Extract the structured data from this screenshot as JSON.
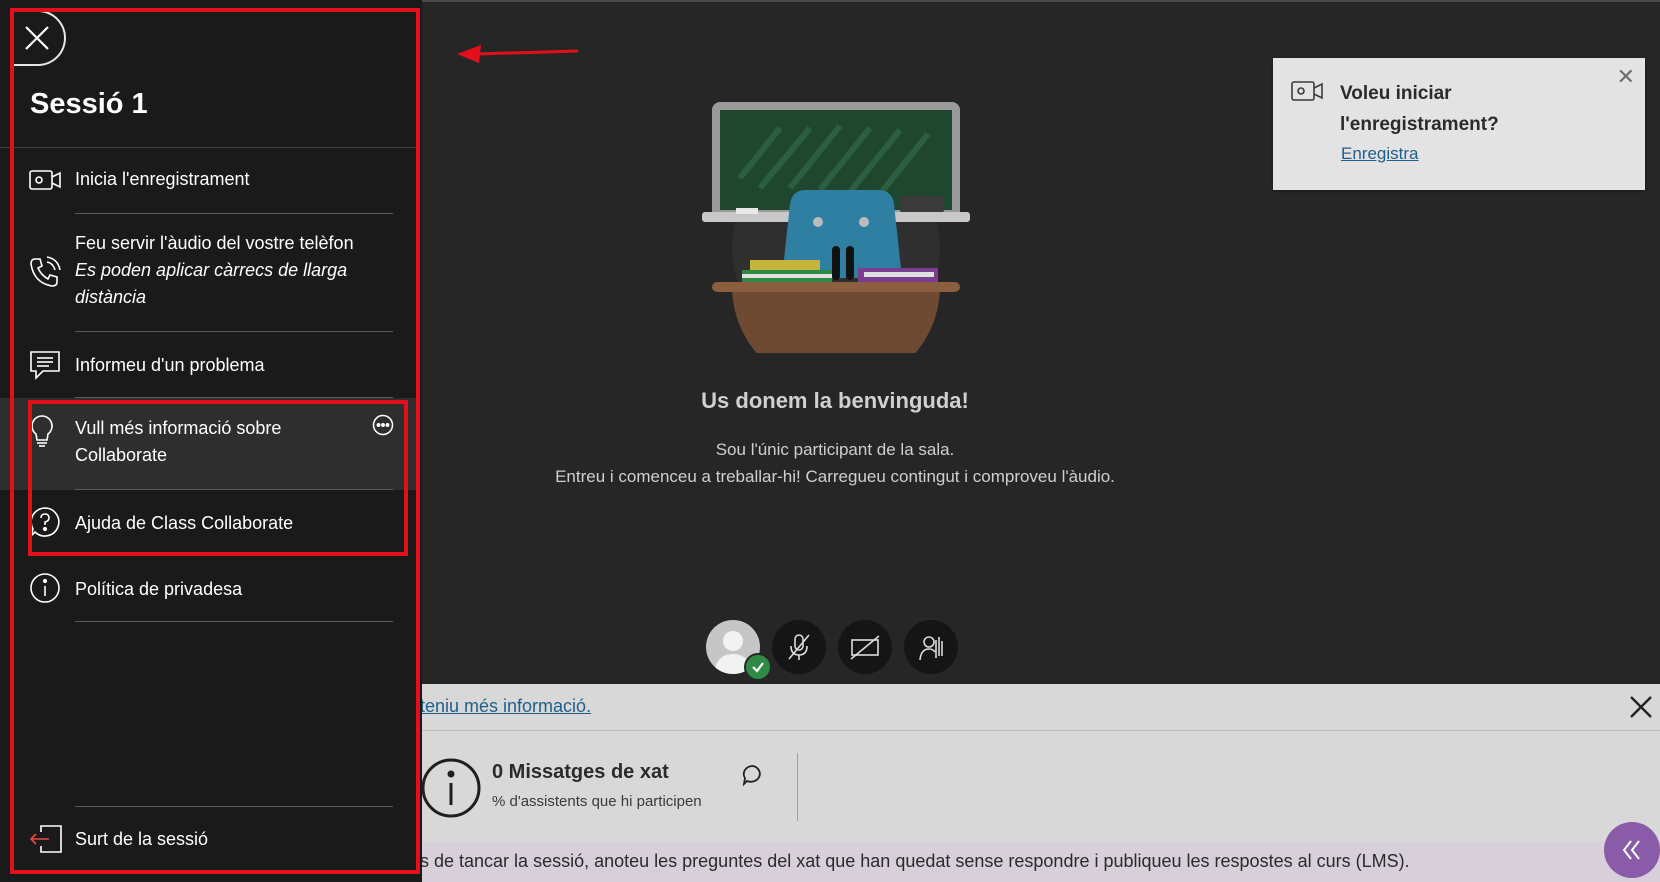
{
  "colors": {
    "accent": "#8a5ba8",
    "annotation": "#e3101b",
    "link": "#1f5f8b",
    "online": "#2e8a45"
  },
  "sidebar": {
    "title": "Sessió 1",
    "items": [
      {
        "label": "Inicia l'enregistrament",
        "icon": "video-camera-icon"
      },
      {
        "label": "Feu servir l'àudio del vostre telèfon",
        "sublabel": "Es poden aplicar càrrecs de llarga distància",
        "icon": "phone-icon"
      },
      {
        "label": "Informeu d'un problema",
        "icon": "report-problem-icon"
      },
      {
        "label": "Vull més informació sobre Collaborate",
        "icon": "lightbulb-icon"
      },
      {
        "label": "Ajuda de Class Collaborate",
        "icon": "help-icon"
      },
      {
        "label": "Política de privadesa",
        "icon": "info-icon"
      }
    ],
    "exit_label": "Surt de la sessió"
  },
  "stage": {
    "welcome_title": "Us donem la benvinguda!",
    "welcome_line1": "Sou l'únic participant de la sala.",
    "welcome_line2": "Entreu i comenceu a treballar-hi! Carregueu contingut i comproveu l'àudio."
  },
  "toast": {
    "question": "Voleu iniciar l'enregistrament?",
    "link": "Enregistra"
  },
  "notice": {
    "link_text": "teniu més informació."
  },
  "stats": {
    "title": "0 Missatges de xat",
    "subtitle": "% d'assistents que hi participen"
  },
  "tip": {
    "text": "s de tancar la sessió, anoteu les preguntes del xat que han quedat sense respondre i publiqueu les respostes al curs (LMS)."
  }
}
